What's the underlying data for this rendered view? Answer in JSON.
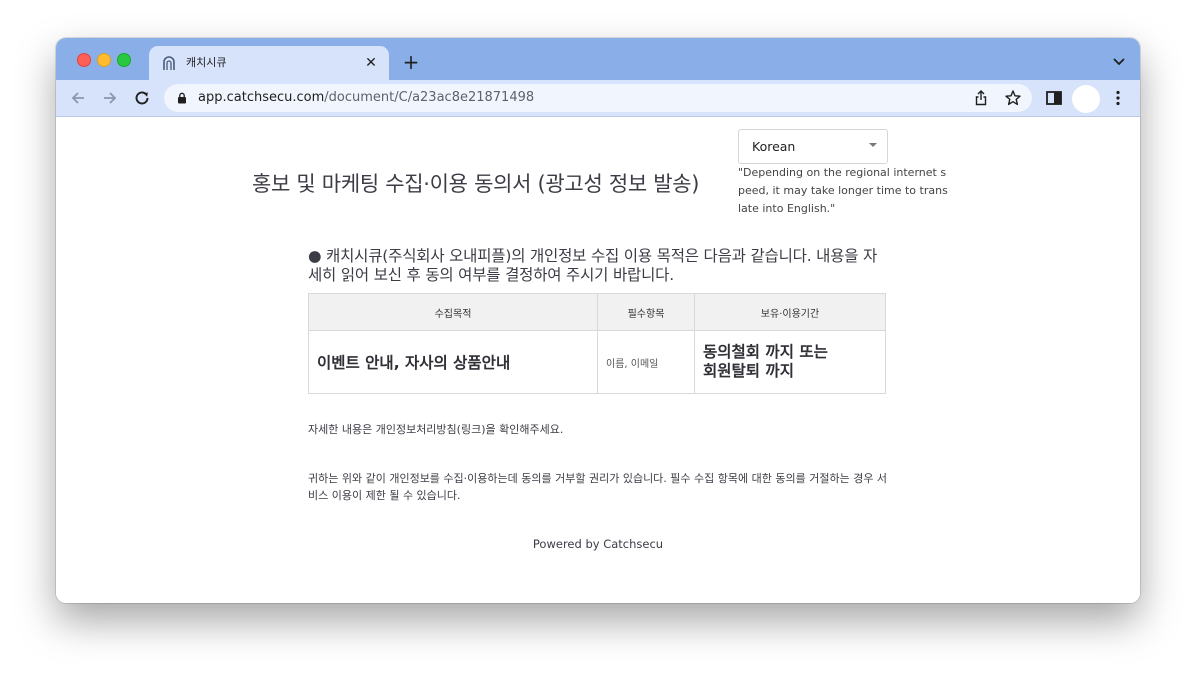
{
  "browser": {
    "tab_title": "캐치시큐",
    "tab_close_glyph": "✕",
    "new_tab_glyph": "+",
    "url_host": "app.catchsecu.com",
    "url_path": "/document/C/a23ac8e21871498"
  },
  "page": {
    "title": "홍보 및 마케팅 수집·이용 동의서 (광고성 정보 발송)",
    "language": {
      "selected": "Korean",
      "note": "\"Depending on the regional internet speed, it may take longer time to translate into English.\""
    },
    "intro": "● 캐치시큐(주식회사 오내피플)의 개인정보 수집 이용 목적은 다음과 같습니다. 내용을 자세히 읽어 보신 후 동의 여부를 결정하여 주시기 바랍니다.",
    "table": {
      "headers": [
        "수집목적",
        "필수항목",
        "보유·이용기간"
      ],
      "row": {
        "purpose": "이벤트 안내, 자사의 상품안내",
        "items": "이름, 이메일",
        "period": "동의철회 까지 또는 회원탈퇴 까지"
      }
    },
    "detail_text": "자세한 내용은 개인정보처리방침(링크)을 확인해주세요.",
    "rights_text": "귀하는 위와 같이 개인정보를 수집·이용하는데 동의를 거부할 권리가 있습니다. 필수 수집 항목에 대한 동의를 거절하는 경우 서비스 이용이 제한 될 수 있습니다.",
    "powered_by": "Powered by Catchsecu"
  }
}
